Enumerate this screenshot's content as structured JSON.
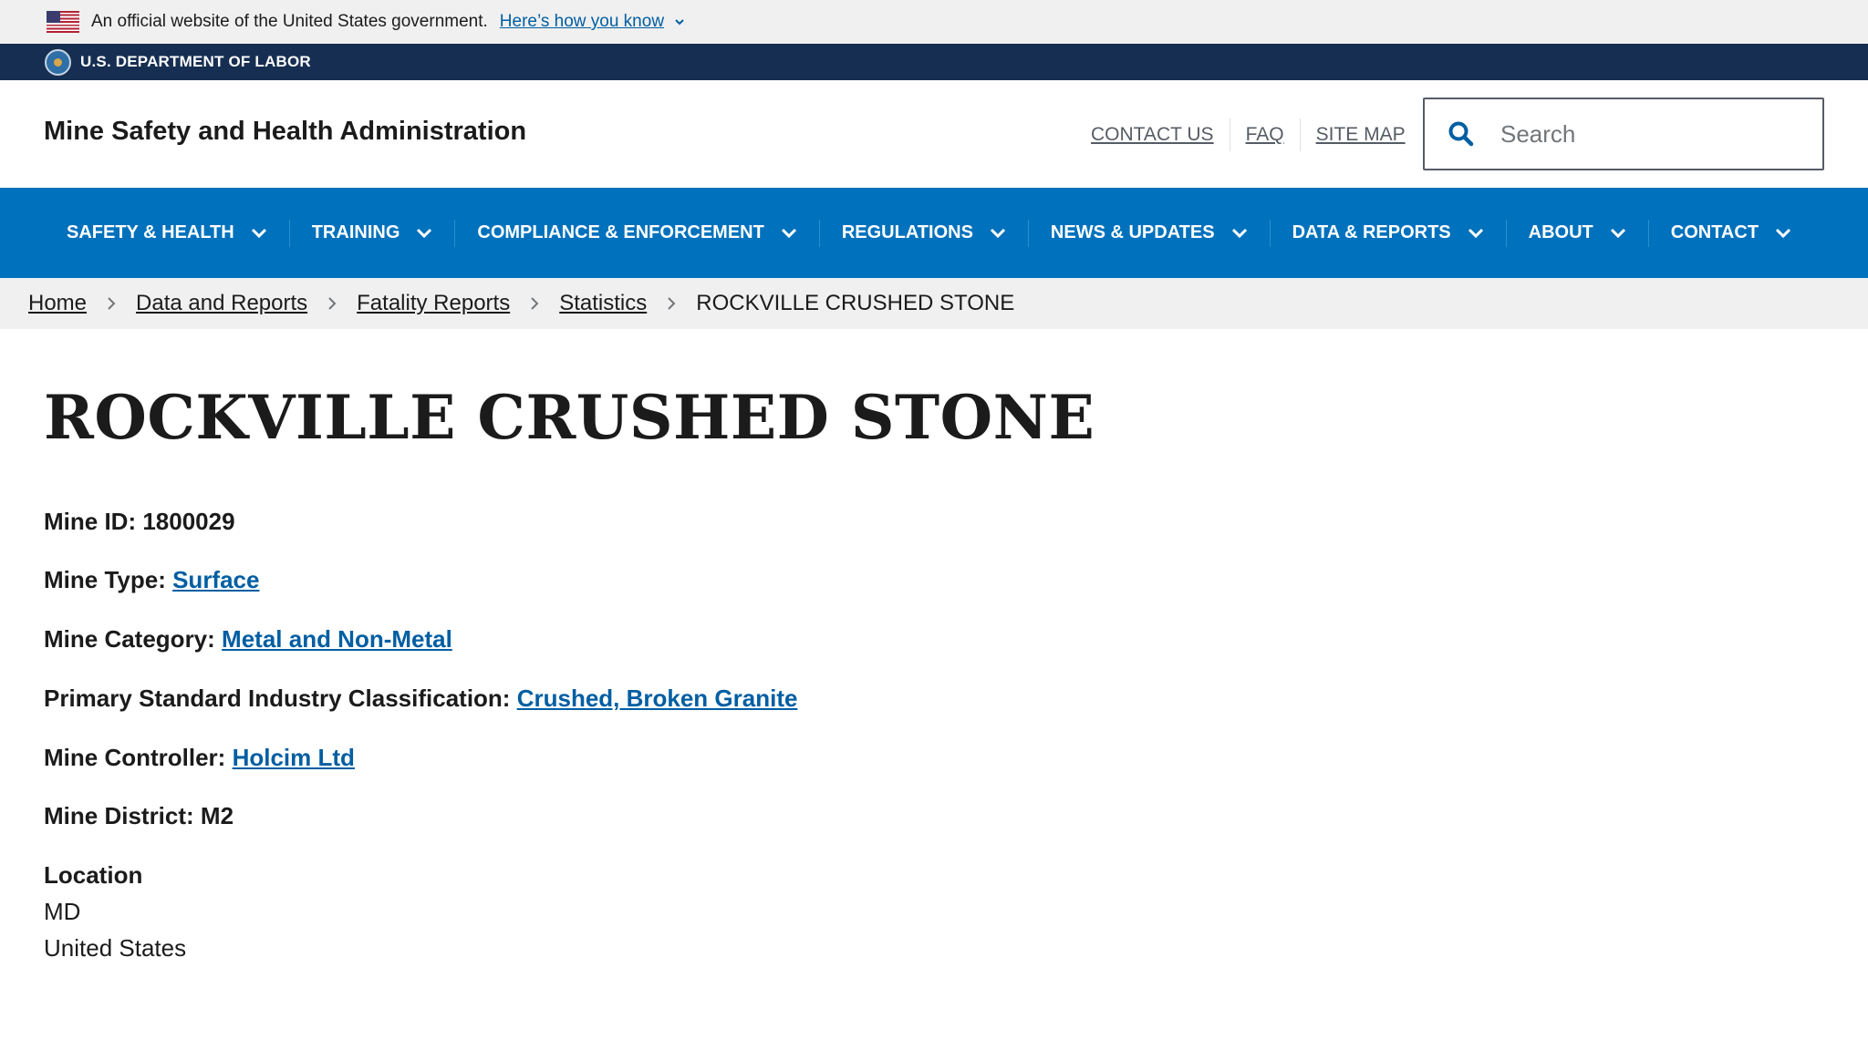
{
  "gov_banner": {
    "text": "An official website of the United States government.",
    "link": "Here’s how you know"
  },
  "agency_bar": {
    "text": "U.S. DEPARTMENT OF LABOR"
  },
  "header": {
    "site_title": "Mine Safety and Health Administration",
    "utility_links": [
      "CONTACT US",
      "FAQ",
      "SITE MAP"
    ],
    "search_placeholder": "Search"
  },
  "nav": {
    "items": [
      "SAFETY & HEALTH",
      "TRAINING",
      "COMPLIANCE & ENFORCEMENT",
      "REGULATIONS",
      "NEWS & UPDATES",
      "DATA & REPORTS",
      "ABOUT",
      "CONTACT"
    ]
  },
  "breadcrumb": {
    "links": [
      "Home",
      "Data and Reports",
      "Fatality Reports",
      "Statistics"
    ],
    "current": "ROCKVILLE CRUSHED STONE"
  },
  "page": {
    "title": "ROCKVILLE CRUSHED STONE",
    "mine_id_label": "Mine ID:",
    "mine_id": "1800029",
    "mine_type_label": "Mine Type:",
    "mine_type": "Surface",
    "mine_category_label": "Mine Category:",
    "mine_category": "Metal and Non-Metal",
    "sic_label": "Primary Standard Industry Classification:",
    "sic": "Crushed, Broken Granite",
    "controller_label": "Mine Controller:",
    "controller": "Holcim Ltd",
    "district_label": "Mine District:",
    "district": "M2",
    "location_label": "Location",
    "location_state": "MD",
    "location_country": "United States"
  },
  "colors": {
    "nav_bg": "#0071bc",
    "agency_bar_bg": "#162e51",
    "link": "#005ea2",
    "banner_bg": "#f0f0f0"
  }
}
